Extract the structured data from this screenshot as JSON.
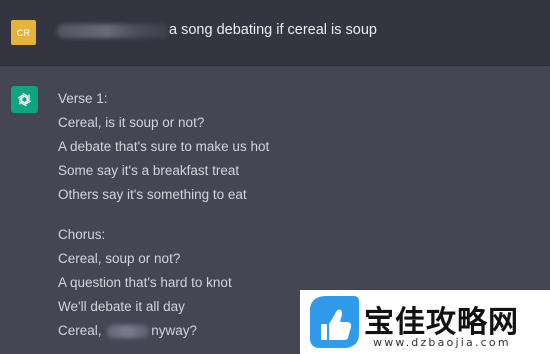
{
  "user": {
    "avatar_initials": "CR",
    "prompt_visible": "a song debating if cereal is soup"
  },
  "assistant": {
    "icon": "openai-logo-icon",
    "verse_label": "Verse 1:",
    "verse_lines": [
      "Cereal, is it soup or not?",
      "A debate that's sure to make us hot",
      "Some say it's a breakfast treat",
      "Others say it's something to eat"
    ],
    "chorus_label": "Chorus:",
    "chorus_lines": [
      "Cereal, soup or not?",
      "A question that's hard to knot",
      "We'll debate it all day"
    ],
    "last_line_start": "Cereal, ",
    "last_line_end": "nyway?"
  },
  "watermark": {
    "title": "宝佳攻略网",
    "domain": "www.dzbaojia.com"
  },
  "colors": {
    "user_bg": "#343541",
    "assistant_bg": "#444654",
    "avatar_user": "#e6b43c",
    "avatar_bot": "#10a37f",
    "text": "#d1d5db"
  }
}
